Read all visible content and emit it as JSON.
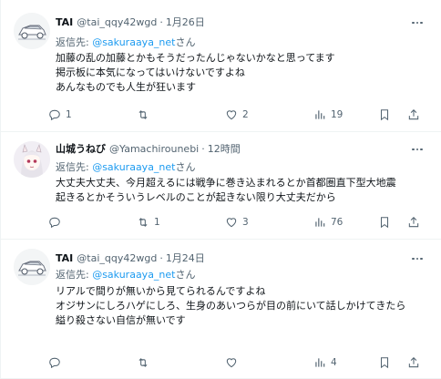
{
  "tweets": [
    {
      "name": "TAI",
      "handle": "@tai_qqy42wgd",
      "dot": "·",
      "date": "1月26日",
      "reply_prefix": "返信先: ",
      "reply_mention": "@sakuraaya_net",
      "reply_suffix": "さん",
      "lines": [
        "加藤の乱の加藤とかもそうだったんじゃないかなと思ってます",
        "掲示板に本気になってはいけないですよね",
        "あんなものでも人生が狂います"
      ],
      "reply_count": "1",
      "retweet_count": "",
      "like_count": "2",
      "view_count": "19",
      "avatar": "car-illustration-avatar"
    },
    {
      "name": "山城うねび",
      "handle": "@Yamachirounebi",
      "dot": "·",
      "date": "12時間",
      "reply_prefix": "返信先: ",
      "reply_mention": "@sakuraaya_net",
      "reply_suffix": "さん",
      "lines": [
        "大丈夫大丈夫、今月超えるには戦争に巻き込まれるとか首都圏直下型大地震",
        "起きるとかそういうレベルのことが起きない限り大丈夫だから"
      ],
      "reply_count": "",
      "retweet_count": "1",
      "like_count": "3",
      "view_count": "76",
      "avatar": "anime-girl-avatar"
    },
    {
      "name": "TAI",
      "handle": "@tai_qqy42wgd",
      "dot": "·",
      "date": "1月24日",
      "reply_prefix": "返信先: ",
      "reply_mention": "@sakuraaya_net",
      "reply_suffix": "さん",
      "lines": [
        "リアルで間りが無いから見てられるんですよね",
        "オジサンにしろハゲにしろ、生身のあいつらが目の前にいて話しかけてきたら",
        "縊り殺さない自信が無いです"
      ],
      "reply_count": "",
      "retweet_count": "",
      "like_count": "",
      "view_count": "4",
      "avatar": "car-illustration-avatar"
    }
  ],
  "colors": {
    "text": "#0f1419",
    "secondary": "#536471",
    "mention": "#1d9bf0",
    "divider": "#eff3f4"
  },
  "icons": [
    "reply-icon",
    "retweet-icon",
    "like-icon",
    "views-icon",
    "bookmark-icon",
    "share-icon",
    "more-icon"
  ]
}
